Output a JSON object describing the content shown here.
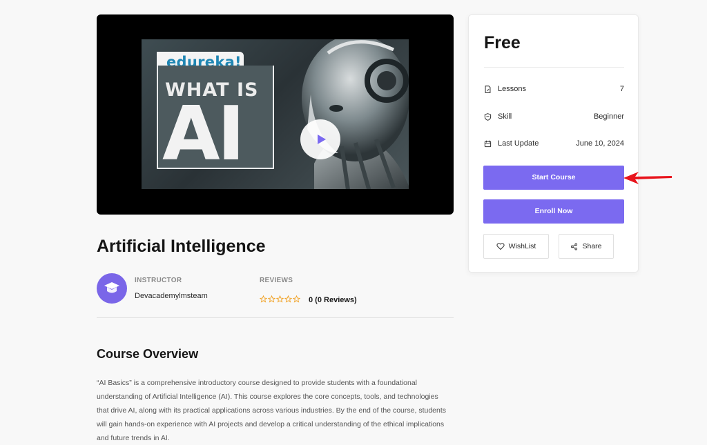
{
  "video": {
    "brand": "edureka!",
    "headline_small": "WHAT IS",
    "headline_large": "AI"
  },
  "course": {
    "title": "Artificial Intelligence",
    "instructor_label": "INSTRUCTOR",
    "instructor_name": "Devacademylmsteam",
    "reviews_label": "REVIEWS",
    "reviews_text": "0 (0 Reviews)",
    "rating_stars": 0
  },
  "overview": {
    "title": "Course Overview",
    "text": "“AI Basics” is a comprehensive introductory course designed to provide students with a foundational understanding of Artificial Intelligence (AI). This course explores the core concepts, tools, and technologies that drive AI, along with its practical applications across various industries. By the end of the course, students will gain hands-on experience with AI projects and develop a critical understanding of the ethical implications and future trends in AI."
  },
  "sidebar": {
    "price": "Free",
    "rows": [
      {
        "label": "Lessons",
        "value": "7",
        "icon": "file-icon"
      },
      {
        "label": "Skill",
        "value": "Beginner",
        "icon": "shield-icon"
      },
      {
        "label": "Last Update",
        "value": "June 10, 2024",
        "icon": "calendar-icon"
      }
    ],
    "start_label": "Start Course",
    "enroll_label": "Enroll Now",
    "wishlist_label": "WishList",
    "share_label": "Share"
  },
  "colors": {
    "accent": "#7b6af0",
    "arrow": "#e8141c"
  }
}
